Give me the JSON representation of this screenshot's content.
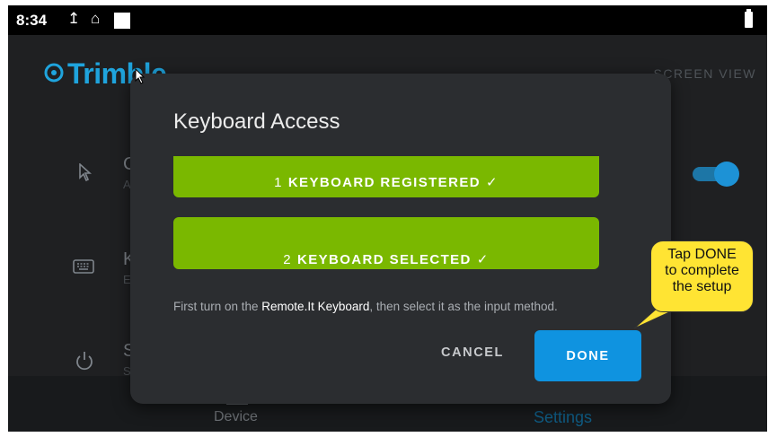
{
  "status_bar": {
    "time": "8:34",
    "icons": [
      "upload-icon",
      "sim-icon",
      "notification-square-icon",
      "battery-icon"
    ]
  },
  "app": {
    "logo_text": "Trimble",
    "screen_view_label": "SCREEN VIEW",
    "background_items": [
      {
        "letter": "C",
        "sub": "A",
        "icon": "pointer-icon"
      },
      {
        "letter": "K",
        "sub": "E",
        "icon": "keyboard-icon"
      },
      {
        "letter": "S",
        "sub": "S",
        "icon": "power-icon"
      }
    ],
    "toggle_on": true
  },
  "bottom_nav": {
    "device_label": "Device",
    "settings_label": "Settings"
  },
  "dialog": {
    "title": "Keyboard Access",
    "step1": {
      "number": "1",
      "label": "KEYBOARD REGISTERED",
      "check": "✓"
    },
    "step2": {
      "number": "2",
      "label": "KEYBOARD SELECTED",
      "check": "✓"
    },
    "instruction_prefix": "First turn on the ",
    "instruction_highlight": "Remote.It Keyboard",
    "instruction_suffix": ", then select it as the input method.",
    "cancel_label": "CANCEL",
    "done_label": "DONE"
  },
  "callout": {
    "line1": "Tap DONE",
    "line2": "to complete",
    "line3": "the setup"
  },
  "colors": {
    "green": "#7ab800",
    "done_blue": "#0f93e0",
    "brand_blue": "#1fa4dd",
    "callout_yellow": "#ffe433"
  }
}
